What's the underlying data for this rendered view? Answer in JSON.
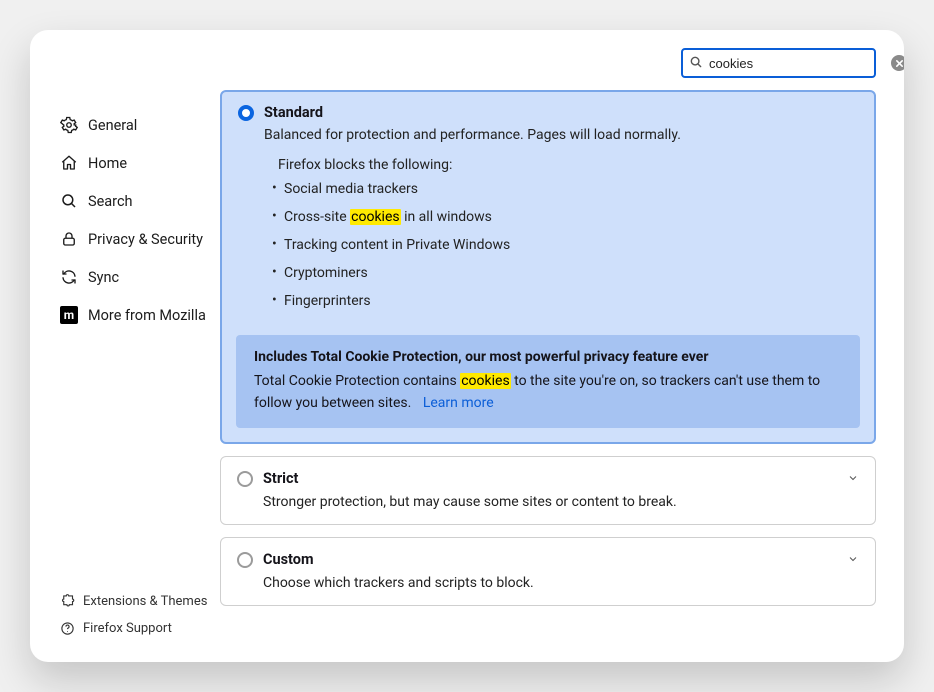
{
  "search": {
    "value": "cookies",
    "placeholder": "Search"
  },
  "sidebar": {
    "items": [
      {
        "label": "General"
      },
      {
        "label": "Home"
      },
      {
        "label": "Search"
      },
      {
        "label": "Privacy & Security"
      },
      {
        "label": "Sync"
      },
      {
        "label": "More from Mozilla"
      }
    ],
    "bottom": [
      {
        "label": "Extensions & Themes"
      },
      {
        "label": "Firefox Support"
      }
    ]
  },
  "etp": {
    "standard": {
      "title": "Standard",
      "desc": "Balanced for protection and performance. Pages will load normally.",
      "blocks_intro": "Firefox blocks the following:",
      "blocks": {
        "b0": "Social media trackers",
        "b1_pre": "Cross-site ",
        "b1_hl": "cookies",
        "b1_post": " in all windows",
        "b2": "Tracking content in Private Windows",
        "b3": "Cryptominers",
        "b4": "Fingerprinters"
      },
      "tcp": {
        "title": "Includes Total Cookie Protection, our most powerful privacy feature ever",
        "body_pre": "Total Cookie Protection contains ",
        "body_hl": "cookies",
        "body_post": " to the site you're on, so trackers can't use them to follow you between sites.",
        "learn": "Learn more"
      }
    },
    "strict": {
      "title": "Strict",
      "desc": "Stronger protection, but may cause some sites or content to break."
    },
    "custom": {
      "title": "Custom",
      "desc": "Choose which trackers and scripts to block."
    }
  },
  "icons": {
    "mozilla_letter": "m"
  }
}
